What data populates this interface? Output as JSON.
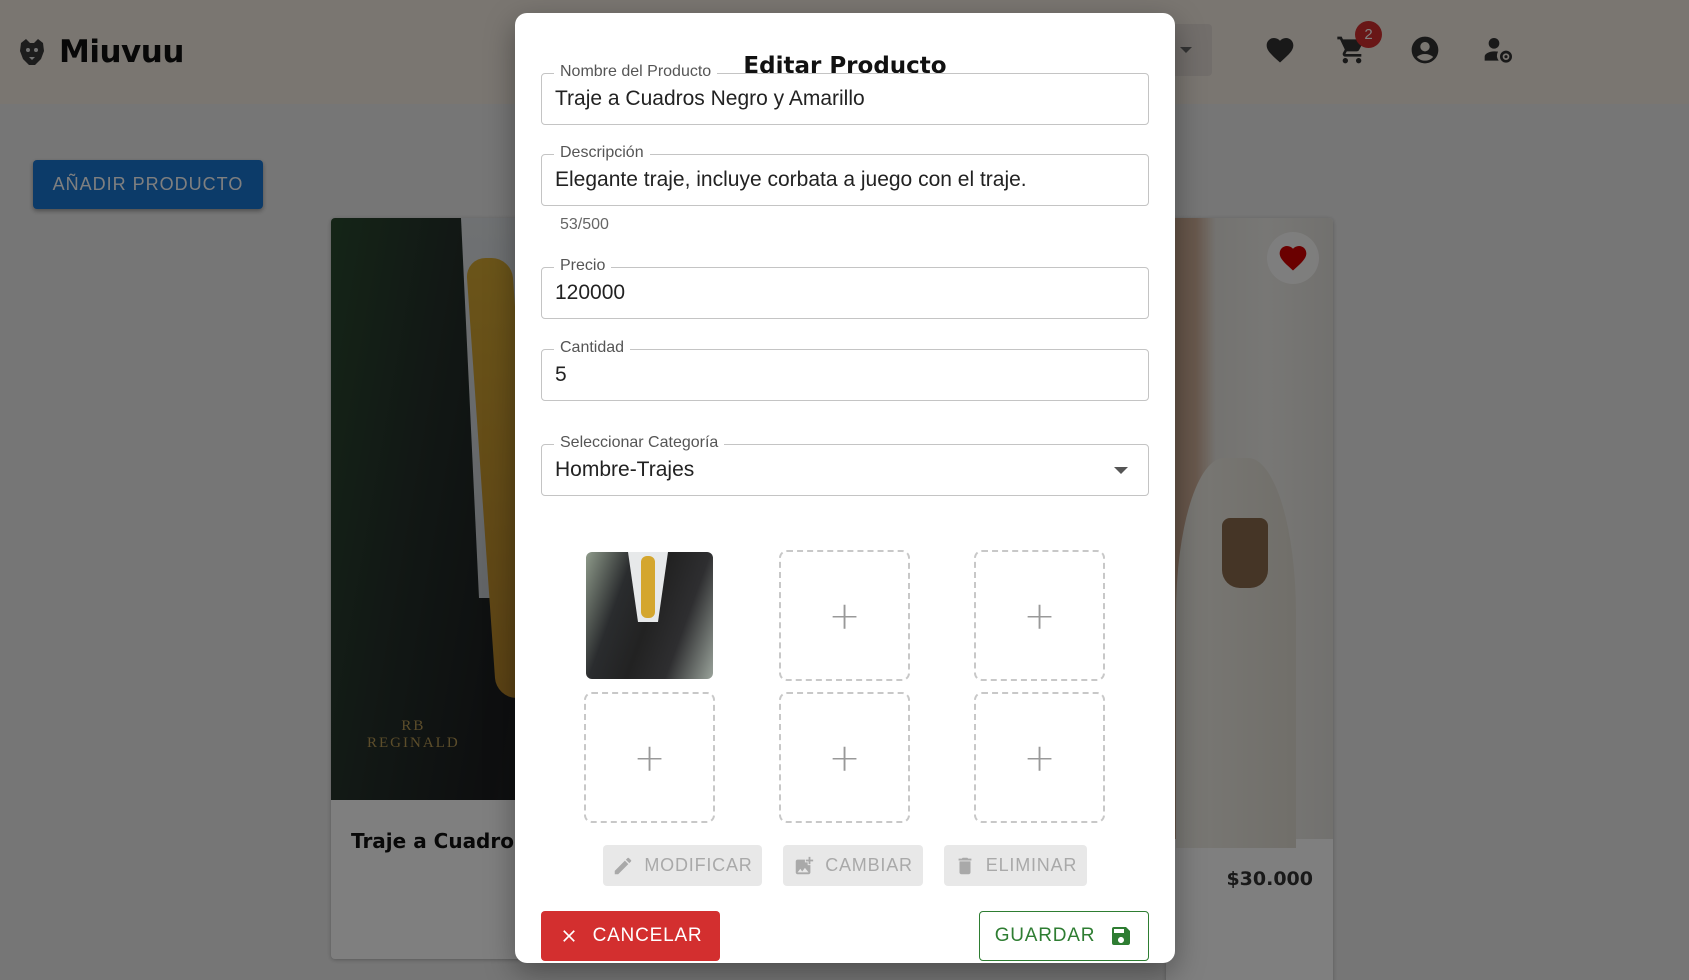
{
  "app": {
    "name": "Miuvuu",
    "cart_count": "2"
  },
  "page": {
    "add_product_label": "AÑADIR PRODUCTO"
  },
  "cards": [
    {
      "title": "Traje a Cuadros N",
      "brand_mark": "RB\nREGINALD"
    },
    {
      "price": "$30.000"
    }
  ],
  "modal": {
    "title": "Editar Producto",
    "fields": {
      "name": {
        "label": "Nombre del Producto",
        "value": "Traje a Cuadros Negro y Amarillo"
      },
      "description": {
        "label": "Descripción",
        "value": "Elegante traje, incluye corbata a juego con el traje.",
        "helper": "53/500"
      },
      "price": {
        "label": "Precio",
        "value": "120000"
      },
      "quantity": {
        "label": "Cantidad",
        "value": "5"
      },
      "category": {
        "label": "Seleccionar Categoría",
        "value": "Hombre-Trajes"
      }
    },
    "image_slots": {
      "plus": "+"
    },
    "image_actions": {
      "modify": "MODIFICAR",
      "change": "CAMBIAR",
      "delete": "ELIMINAR"
    },
    "cancel_label": "CANCELAR",
    "save_label": "GUARDAR"
  },
  "colors": {
    "primary": "#1976d2",
    "danger": "#d32f2f",
    "success": "#2e7d32",
    "badge": "#d32f2f",
    "navbar": "#f5ece3"
  },
  "icons": [
    "jaguar-logo-icon",
    "heart-icon",
    "cart-icon",
    "account-circle-icon",
    "admin-settings-icon",
    "pencil-icon",
    "add-photo-icon",
    "trash-icon",
    "close-icon",
    "save-icon",
    "plus-icon"
  ]
}
